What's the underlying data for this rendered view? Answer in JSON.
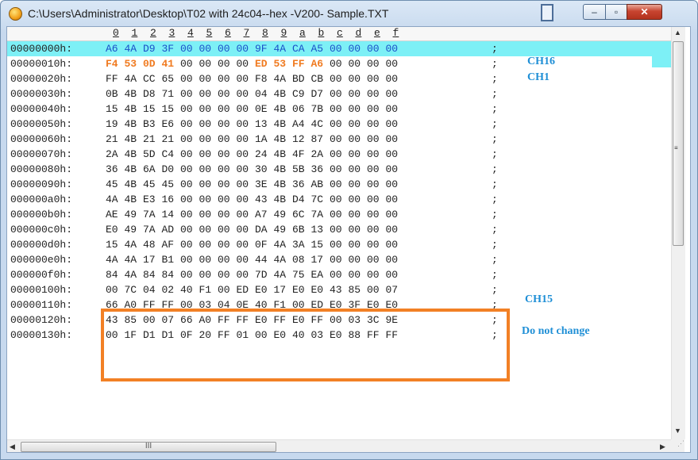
{
  "window": {
    "title": "C:\\Users\\Administrator\\Desktop\\T02 with 24c04--hex -V200- Sample.TXT",
    "close_glyph": "✕",
    "max_glyph": "▫",
    "min_glyph": "–"
  },
  "ruler": [
    "0",
    "1",
    "2",
    "3",
    "4",
    "5",
    "6",
    "7",
    "8",
    "9",
    "a",
    "b",
    "c",
    "d",
    "e",
    "f"
  ],
  "rows": [
    {
      "addr": "00000000h:",
      "bytes": [
        "A6",
        "4A",
        "D9",
        "3F",
        "00",
        "00",
        "00",
        "00",
        "9F",
        "4A",
        "CA",
        "A5",
        "00",
        "00",
        "00",
        "00"
      ],
      "sep": ";"
    },
    {
      "addr": "00000010h:",
      "bytes": [
        "F4",
        "53",
        "0D",
        "41",
        "00",
        "00",
        "00",
        "00",
        "ED",
        "53",
        "FF",
        "A6",
        "00",
        "00",
        "00",
        "00"
      ],
      "sep": ";"
    },
    {
      "addr": "00000020h:",
      "bytes": [
        "FF",
        "4A",
        "CC",
        "65",
        "00",
        "00",
        "00",
        "00",
        "F8",
        "4A",
        "BD",
        "CB",
        "00",
        "00",
        "00",
        "00"
      ],
      "sep": ";"
    },
    {
      "addr": "00000030h:",
      "bytes": [
        "0B",
        "4B",
        "D8",
        "71",
        "00",
        "00",
        "00",
        "00",
        "04",
        "4B",
        "C9",
        "D7",
        "00",
        "00",
        "00",
        "00"
      ],
      "sep": ";"
    },
    {
      "addr": "00000040h:",
      "bytes": [
        "15",
        "4B",
        "15",
        "15",
        "00",
        "00",
        "00",
        "00",
        "0E",
        "4B",
        "06",
        "7B",
        "00",
        "00",
        "00",
        "00"
      ],
      "sep": ";"
    },
    {
      "addr": "00000050h:",
      "bytes": [
        "19",
        "4B",
        "B3",
        "E6",
        "00",
        "00",
        "00",
        "00",
        "13",
        "4B",
        "A4",
        "4C",
        "00",
        "00",
        "00",
        "00"
      ],
      "sep": ";"
    },
    {
      "addr": "00000060h:",
      "bytes": [
        "21",
        "4B",
        "21",
        "21",
        "00",
        "00",
        "00",
        "00",
        "1A",
        "4B",
        "12",
        "87",
        "00",
        "00",
        "00",
        "00"
      ],
      "sep": ";"
    },
    {
      "addr": "00000070h:",
      "bytes": [
        "2A",
        "4B",
        "5D",
        "C4",
        "00",
        "00",
        "00",
        "00",
        "24",
        "4B",
        "4F",
        "2A",
        "00",
        "00",
        "00",
        "00"
      ],
      "sep": ";"
    },
    {
      "addr": "00000080h:",
      "bytes": [
        "36",
        "4B",
        "6A",
        "D0",
        "00",
        "00",
        "00",
        "00",
        "30",
        "4B",
        "5B",
        "36",
        "00",
        "00",
        "00",
        "00"
      ],
      "sep": ";"
    },
    {
      "addr": "00000090h:",
      "bytes": [
        "45",
        "4B",
        "45",
        "45",
        "00",
        "00",
        "00",
        "00",
        "3E",
        "4B",
        "36",
        "AB",
        "00",
        "00",
        "00",
        "00"
      ],
      "sep": ";"
    },
    {
      "addr": "000000a0h:",
      "bytes": [
        "4A",
        "4B",
        "E3",
        "16",
        "00",
        "00",
        "00",
        "00",
        "43",
        "4B",
        "D4",
        "7C",
        "00",
        "00",
        "00",
        "00"
      ],
      "sep": ";"
    },
    {
      "addr": "000000b0h:",
      "bytes": [
        "AE",
        "49",
        "7A",
        "14",
        "00",
        "00",
        "00",
        "00",
        "A7",
        "49",
        "6C",
        "7A",
        "00",
        "00",
        "00",
        "00"
      ],
      "sep": ";"
    },
    {
      "addr": "000000c0h:",
      "bytes": [
        "E0",
        "49",
        "7A",
        "AD",
        "00",
        "00",
        "00",
        "00",
        "DA",
        "49",
        "6B",
        "13",
        "00",
        "00",
        "00",
        "00"
      ],
      "sep": ";"
    },
    {
      "addr": "000000d0h:",
      "bytes": [
        "15",
        "4A",
        "48",
        "AF",
        "00",
        "00",
        "00",
        "00",
        "0F",
        "4A",
        "3A",
        "15",
        "00",
        "00",
        "00",
        "00"
      ],
      "sep": ";"
    },
    {
      "addr": "000000e0h:",
      "bytes": [
        "4A",
        "4A",
        "17",
        "B1",
        "00",
        "00",
        "00",
        "00",
        "44",
        "4A",
        "08",
        "17",
        "00",
        "00",
        "00",
        "00"
      ],
      "sep": ";"
    },
    {
      "addr": "000000f0h:",
      "bytes": [
        "84",
        "4A",
        "84",
        "84",
        "00",
        "00",
        "00",
        "00",
        "7D",
        "4A",
        "75",
        "EA",
        "00",
        "00",
        "00",
        "00"
      ],
      "sep": ";"
    },
    {
      "addr": "00000100h:",
      "bytes": [
        "00",
        "7C",
        "04",
        "02",
        "40",
        "F1",
        "00",
        "ED",
        "E0",
        "17",
        "E0",
        "E0",
        "43",
        "85",
        "00",
        "07"
      ],
      "sep": ";"
    },
    {
      "addr": "00000110h:",
      "bytes": [
        "66",
        "A0",
        "FF",
        "FF",
        "00",
        "03",
        "04",
        "0E",
        "40",
        "F1",
        "00",
        "ED",
        "E0",
        "3F",
        "E0",
        "E0"
      ],
      "sep": ";"
    },
    {
      "addr": "00000120h:",
      "bytes": [
        "43",
        "85",
        "00",
        "07",
        "66",
        "A0",
        "FF",
        "FF",
        "E0",
        "FF",
        "E0",
        "FF",
        "00",
        "03",
        "3C",
        "9E"
      ],
      "sep": ";"
    },
    {
      "addr": "00000130h:",
      "bytes": [
        "00",
        "1F",
        "D1",
        "D1",
        "0F",
        "20",
        "FF",
        "01",
        "00",
        "E0",
        "40",
        "03",
        "E0",
        "88",
        "FF",
        "FF"
      ],
      "sep": ";"
    }
  ],
  "highlight": {
    "row": 1,
    "cells": [
      0,
      1,
      2,
      3,
      8,
      9,
      10,
      11
    ],
    "color": "#f07b21"
  },
  "selection_color": "#7df0f6",
  "box_color": "#f28025",
  "notes": {
    "ch16": "CH16",
    "ch1": "CH1",
    "ch15": "CH15",
    "do_not_change": "Do not change"
  },
  "scroll": {
    "hthumb_grip": "III"
  }
}
